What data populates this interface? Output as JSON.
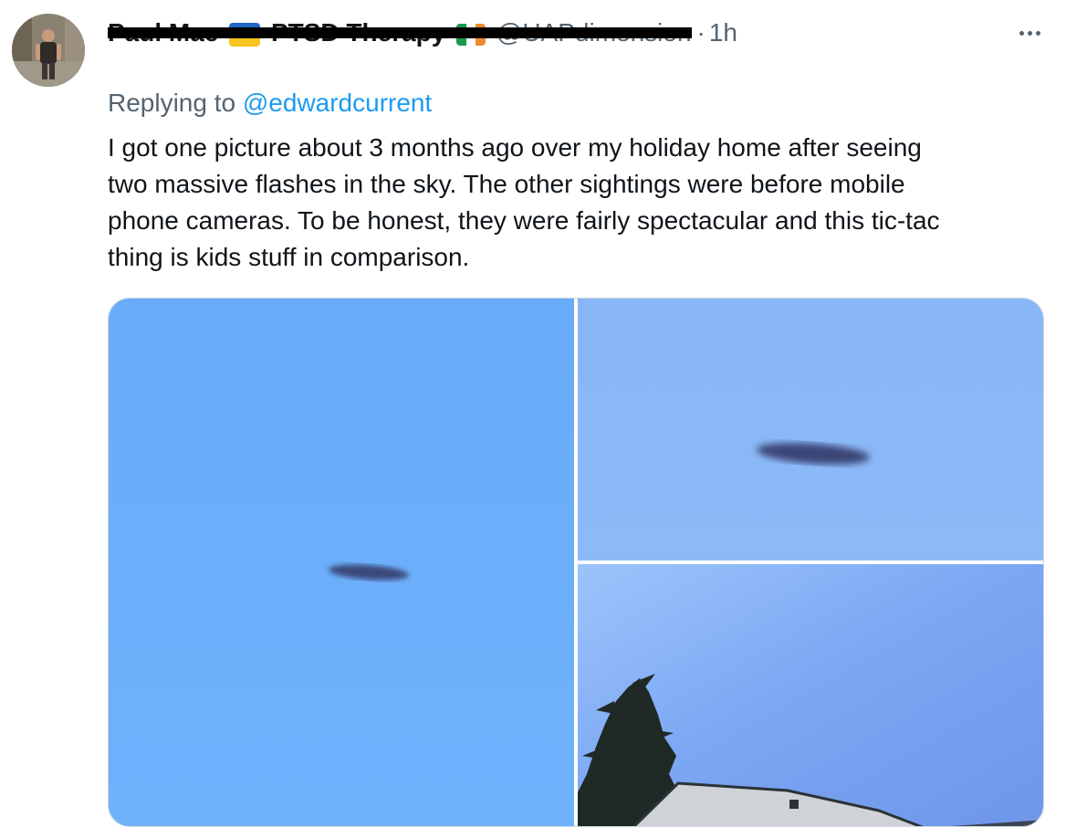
{
  "tweet": {
    "display_name": "Paul Mac",
    "display_name_suffix": "PTSD Therapy",
    "handle": "@UAPdimension",
    "separator": "·",
    "time": "1h",
    "reply_prefix": "Replying to",
    "reply_to": "@edwardcurrent",
    "text": "I got one picture about 3 months ago over my holiday home after seeing\ntwo massive flashes in the sky. The other sightings were before mobile\nphone cameras. To be honest, they were fairly spectacular and this tic-tac\nthing is kids stuff in comparison."
  },
  "icons": {
    "more": "more-horizontal-icon",
    "flag_1": "ukraine-flag-icon",
    "flag_2": "ireland-flag-icon"
  },
  "colors": {
    "text": "#0f1419",
    "secondary": "#536471",
    "link": "#1d9bf0",
    "border": "#cfd9de",
    "sky_1": "#6aadfb",
    "sky_2": "#8ab8f6",
    "sky_3": "#7ba6f1"
  }
}
